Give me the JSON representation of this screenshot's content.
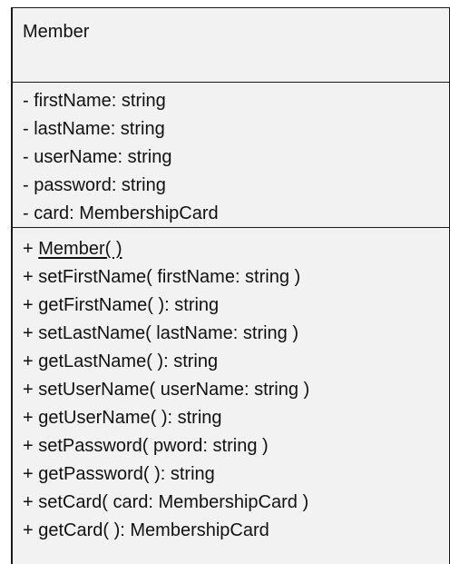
{
  "class_box": {
    "name": "Member",
    "attributes": [
      "- firstName: string",
      "- lastName: string",
      "- userName: string",
      "- password: string",
      "- card: MembershipCard"
    ],
    "operations": [
      {
        "visibility": "+",
        "signature": "Member( )",
        "underlined": true
      },
      {
        "visibility": "+",
        "signature": "setFirstName( firstName: string )",
        "underlined": false
      },
      {
        "visibility": "+",
        "signature": "getFirstName( ): string",
        "underlined": false
      },
      {
        "visibility": "+",
        "signature": "setLastName( lastName: string )",
        "underlined": false
      },
      {
        "visibility": "+",
        "signature": "getLastName( ): string",
        "underlined": false
      },
      {
        "visibility": "+",
        "signature": "setUserName( userName: string )",
        "underlined": false
      },
      {
        "visibility": "+",
        "signature": "getUserName( ): string",
        "underlined": false
      },
      {
        "visibility": "+",
        "signature": "setPassword( pword: string )",
        "underlined": false
      },
      {
        "visibility": "+",
        "signature": "getPassword( ): string",
        "underlined": false
      },
      {
        "visibility": "+",
        "signature": "setCard( card: MembershipCard )",
        "underlined": false
      },
      {
        "visibility": "+",
        "signature": "getCard( ): MembershipCard",
        "underlined": false
      }
    ]
  },
  "colors": {
    "box_fill": "#f2f2f2",
    "border": "#1a1a1a",
    "text": "#111111"
  }
}
